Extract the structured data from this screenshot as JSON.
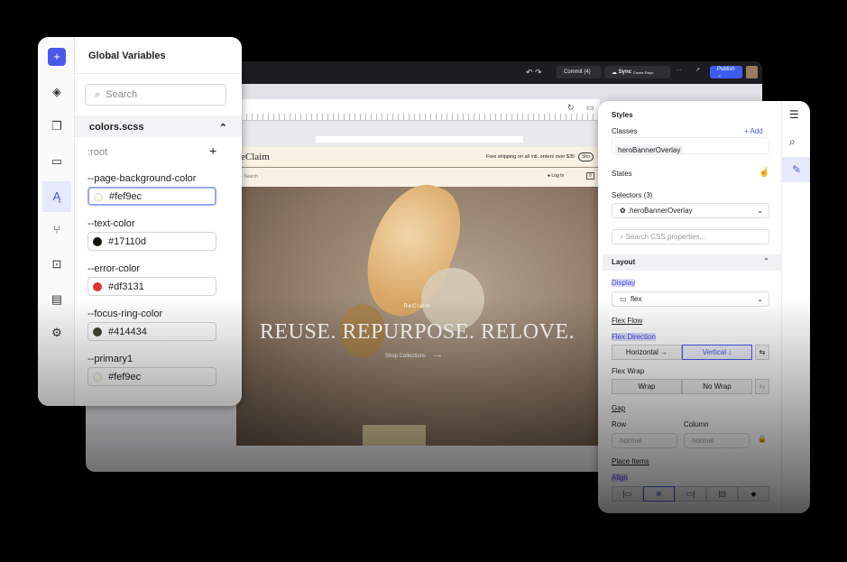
{
  "editor": {
    "commit": "Commit (4)",
    "sync": "Sync",
    "sync_sub": "Create Repo",
    "more": "...",
    "publish": "Publish ⌄"
  },
  "site": {
    "brand": "eClaim",
    "announcement": "Free shipping on all intl. orders over $35",
    "shop_btn": "Sho",
    "search": "Search",
    "login": "Log In",
    "cart": "0",
    "hero_brand": "ReClaim",
    "hero_title": "REUSE. REPURPOSE. RELOVE.",
    "hero_cta": "Shop Collections",
    "arrow": "⟶"
  },
  "variables": {
    "title": "Global Variables",
    "search_placeholder": "Search",
    "file": "colors.scss",
    "scope": ":root",
    "add": "+",
    "items": [
      {
        "name": "--page-background-color",
        "value": "#fef9ec",
        "color": "#fef9ec"
      },
      {
        "name": "--text-color",
        "value": "#17110d",
        "color": "#17110d"
      },
      {
        "name": "--error-color",
        "value": "#df3131",
        "color": "#df3131"
      },
      {
        "name": "--focus-ring-color",
        "value": "#414434",
        "color": "#414434"
      },
      {
        "name": "--primary1",
        "value": "#fef9ec",
        "color": "#fef9ec"
      }
    ]
  },
  "styles": {
    "title": "Styles",
    "classes": "Classes",
    "add": "+ Add",
    "class_tag": "heroBannerOverlay",
    "states": "States",
    "selectors": "Selectors (3)",
    "selector_value": ".heroBannerOverlay",
    "search_placeholder": "Search CSS properties...",
    "layout": "Layout",
    "display": "Display",
    "display_value": "flex",
    "flex_flow": "Flex Flow",
    "flex_direction": "Flex Direction",
    "horizontal": "Horizontal →",
    "vertical": "Vertical ↓",
    "flex_wrap": "Flex Wrap",
    "wrap": "Wrap",
    "no_wrap": "No Wrap",
    "gap": "Gap",
    "row": "Row",
    "column": "Column",
    "row_value": "normal",
    "column_value": "normal",
    "place_items": "Place Items",
    "align": "Align"
  },
  "colors": {
    "accent": "#4a5ae8",
    "publish": "#3f5cf0"
  }
}
